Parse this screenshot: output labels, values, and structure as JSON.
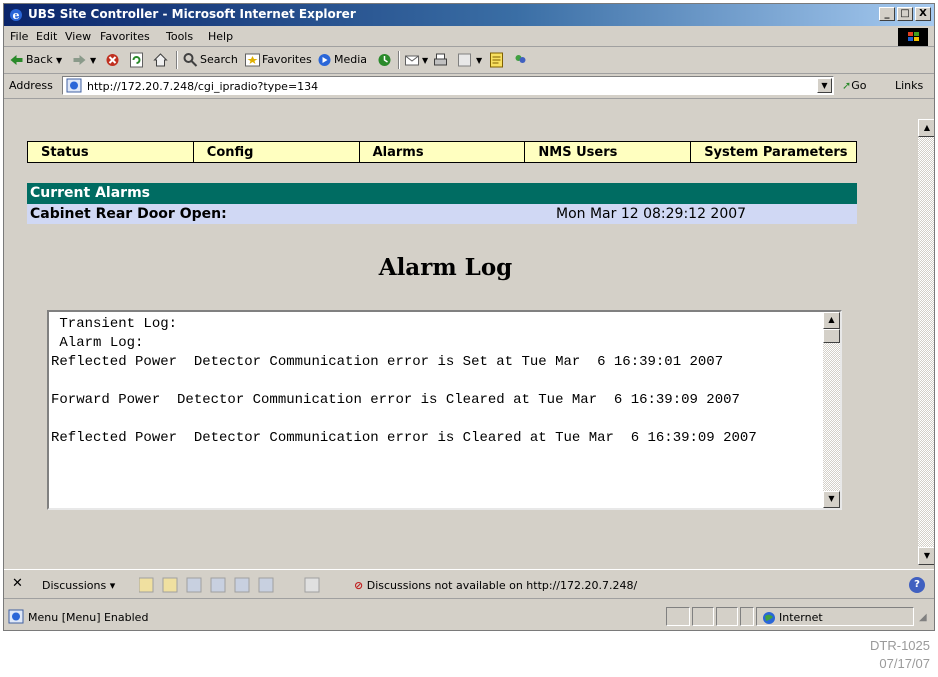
{
  "window": {
    "title": "UBS Site Controller - Microsoft Internet Explorer",
    "buttons": {
      "minimize": "_",
      "maximize": "□",
      "close": "X"
    }
  },
  "menubar": {
    "file": "File",
    "edit": "Edit",
    "view": "View",
    "favorites": "Favorites",
    "tools": "Tools",
    "help": "Help"
  },
  "toolbar": {
    "back": "Back",
    "search": "Search",
    "favorites": "Favorites",
    "media": "Media"
  },
  "address": {
    "label": "Address",
    "url": "http://172.20.7.248/cgi_ipradio?type=134",
    "go": "Go",
    "links": "Links"
  },
  "nav": {
    "status": "Status",
    "config": "Config",
    "alarms": "Alarms",
    "nms_users": "NMS Users",
    "system_parameters": "System Parameters"
  },
  "current_alarms": {
    "header": "Current Alarms",
    "rows": [
      {
        "name": "Cabinet Rear Door Open:",
        "time": "Mon Mar 12 08:29:12 2007"
      }
    ]
  },
  "alarm_log": {
    "title": "Alarm Log",
    "text": " Transient Log:\n Alarm Log:\nReflected Power  Detector Communication error is Set at Tue Mar  6 16:39:01 2007\n\nForward Power  Detector Communication error is Cleared at Tue Mar  6 16:39:09 2007\n\nReflected Power  Detector Communication error is Cleared at Tue Mar  6 16:39:09 2007"
  },
  "discussions": {
    "label": "Discussions",
    "message": "Discussions not available on http://172.20.7.248/"
  },
  "statusbar": {
    "text": "Menu [Menu] Enabled",
    "zone": "Internet"
  },
  "watermark": {
    "line1": "DTR-1025",
    "line2": "07/17/07"
  },
  "colors": {
    "title_gradient_start": "#0a246a",
    "nav_background": "#ffffc0",
    "alarm_header": "#006c62",
    "alarm_row": "#d0d8f4",
    "chrome": "#d4d0c8"
  }
}
